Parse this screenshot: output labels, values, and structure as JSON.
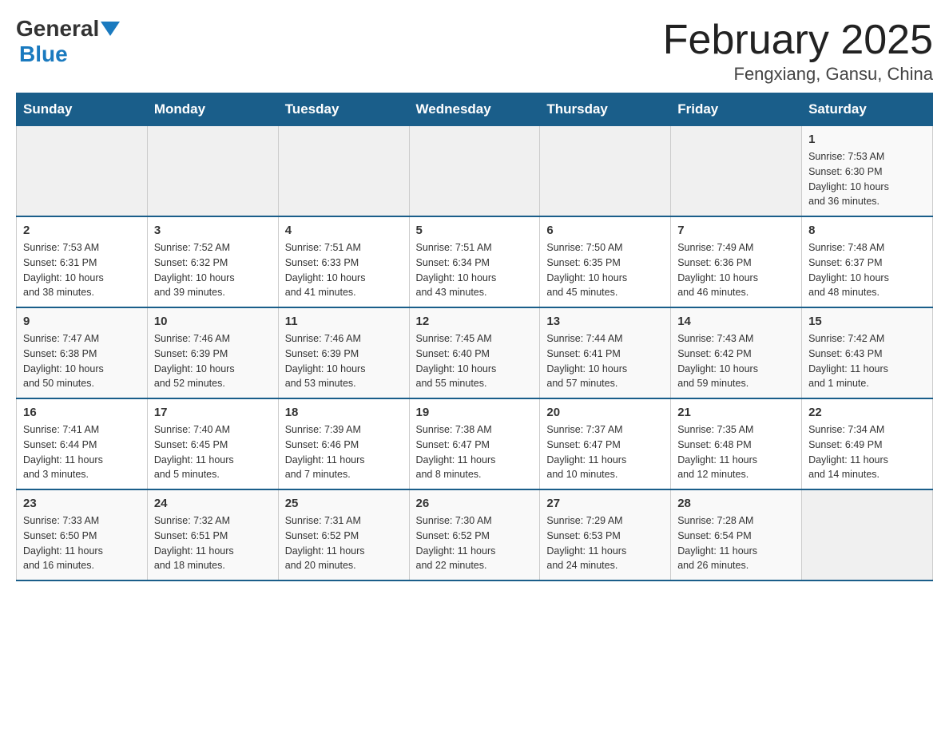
{
  "header": {
    "logo": {
      "general": "General",
      "blue": "Blue"
    },
    "title": "February 2025",
    "location": "Fengxiang, Gansu, China"
  },
  "weekdays": [
    "Sunday",
    "Monday",
    "Tuesday",
    "Wednesday",
    "Thursday",
    "Friday",
    "Saturday"
  ],
  "weeks": [
    [
      {
        "day": "",
        "info": ""
      },
      {
        "day": "",
        "info": ""
      },
      {
        "day": "",
        "info": ""
      },
      {
        "day": "",
        "info": ""
      },
      {
        "day": "",
        "info": ""
      },
      {
        "day": "",
        "info": ""
      },
      {
        "day": "1",
        "info": "Sunrise: 7:53 AM\nSunset: 6:30 PM\nDaylight: 10 hours\nand 36 minutes."
      }
    ],
    [
      {
        "day": "2",
        "info": "Sunrise: 7:53 AM\nSunset: 6:31 PM\nDaylight: 10 hours\nand 38 minutes."
      },
      {
        "day": "3",
        "info": "Sunrise: 7:52 AM\nSunset: 6:32 PM\nDaylight: 10 hours\nand 39 minutes."
      },
      {
        "day": "4",
        "info": "Sunrise: 7:51 AM\nSunset: 6:33 PM\nDaylight: 10 hours\nand 41 minutes."
      },
      {
        "day": "5",
        "info": "Sunrise: 7:51 AM\nSunset: 6:34 PM\nDaylight: 10 hours\nand 43 minutes."
      },
      {
        "day": "6",
        "info": "Sunrise: 7:50 AM\nSunset: 6:35 PM\nDaylight: 10 hours\nand 45 minutes."
      },
      {
        "day": "7",
        "info": "Sunrise: 7:49 AM\nSunset: 6:36 PM\nDaylight: 10 hours\nand 46 minutes."
      },
      {
        "day": "8",
        "info": "Sunrise: 7:48 AM\nSunset: 6:37 PM\nDaylight: 10 hours\nand 48 minutes."
      }
    ],
    [
      {
        "day": "9",
        "info": "Sunrise: 7:47 AM\nSunset: 6:38 PM\nDaylight: 10 hours\nand 50 minutes."
      },
      {
        "day": "10",
        "info": "Sunrise: 7:46 AM\nSunset: 6:39 PM\nDaylight: 10 hours\nand 52 minutes."
      },
      {
        "day": "11",
        "info": "Sunrise: 7:46 AM\nSunset: 6:39 PM\nDaylight: 10 hours\nand 53 minutes."
      },
      {
        "day": "12",
        "info": "Sunrise: 7:45 AM\nSunset: 6:40 PM\nDaylight: 10 hours\nand 55 minutes."
      },
      {
        "day": "13",
        "info": "Sunrise: 7:44 AM\nSunset: 6:41 PM\nDaylight: 10 hours\nand 57 minutes."
      },
      {
        "day": "14",
        "info": "Sunrise: 7:43 AM\nSunset: 6:42 PM\nDaylight: 10 hours\nand 59 minutes."
      },
      {
        "day": "15",
        "info": "Sunrise: 7:42 AM\nSunset: 6:43 PM\nDaylight: 11 hours\nand 1 minute."
      }
    ],
    [
      {
        "day": "16",
        "info": "Sunrise: 7:41 AM\nSunset: 6:44 PM\nDaylight: 11 hours\nand 3 minutes."
      },
      {
        "day": "17",
        "info": "Sunrise: 7:40 AM\nSunset: 6:45 PM\nDaylight: 11 hours\nand 5 minutes."
      },
      {
        "day": "18",
        "info": "Sunrise: 7:39 AM\nSunset: 6:46 PM\nDaylight: 11 hours\nand 7 minutes."
      },
      {
        "day": "19",
        "info": "Sunrise: 7:38 AM\nSunset: 6:47 PM\nDaylight: 11 hours\nand 8 minutes."
      },
      {
        "day": "20",
        "info": "Sunrise: 7:37 AM\nSunset: 6:47 PM\nDaylight: 11 hours\nand 10 minutes."
      },
      {
        "day": "21",
        "info": "Sunrise: 7:35 AM\nSunset: 6:48 PM\nDaylight: 11 hours\nand 12 minutes."
      },
      {
        "day": "22",
        "info": "Sunrise: 7:34 AM\nSunset: 6:49 PM\nDaylight: 11 hours\nand 14 minutes."
      }
    ],
    [
      {
        "day": "23",
        "info": "Sunrise: 7:33 AM\nSunset: 6:50 PM\nDaylight: 11 hours\nand 16 minutes."
      },
      {
        "day": "24",
        "info": "Sunrise: 7:32 AM\nSunset: 6:51 PM\nDaylight: 11 hours\nand 18 minutes."
      },
      {
        "day": "25",
        "info": "Sunrise: 7:31 AM\nSunset: 6:52 PM\nDaylight: 11 hours\nand 20 minutes."
      },
      {
        "day": "26",
        "info": "Sunrise: 7:30 AM\nSunset: 6:52 PM\nDaylight: 11 hours\nand 22 minutes."
      },
      {
        "day": "27",
        "info": "Sunrise: 7:29 AM\nSunset: 6:53 PM\nDaylight: 11 hours\nand 24 minutes."
      },
      {
        "day": "28",
        "info": "Sunrise: 7:28 AM\nSunset: 6:54 PM\nDaylight: 11 hours\nand 26 minutes."
      },
      {
        "day": "",
        "info": ""
      }
    ]
  ]
}
